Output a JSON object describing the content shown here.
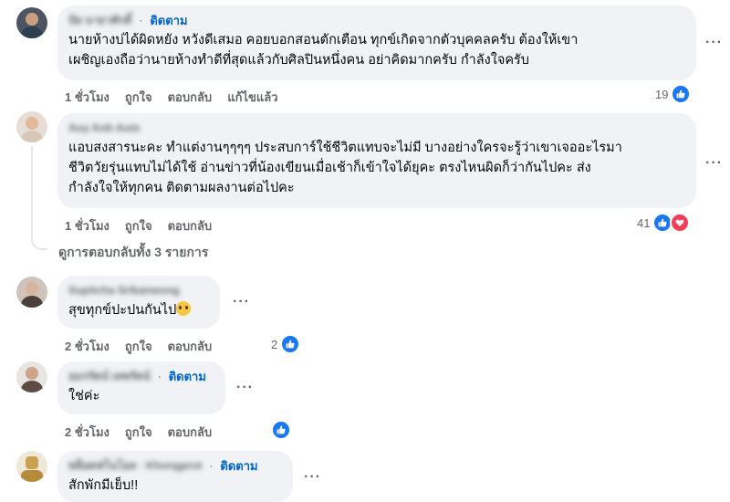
{
  "comments": [
    {
      "author": "ปัย นายาศักดิ์",
      "follow": "ติดตาม",
      "lines": [
        "นายห้างบ่ได้ผิดหยัง หวังดีเสมอ คอยบอกสอนตักเตือน ทุกข์เกิดจากตัวบุคคลครับ ต้องให้เขา",
        "เผชิญเองถือว่านายห้างทำดีที่สุดแล้วกับศิลปินหนึ่งคน อย่าคิดมากครับ กำลังใจครับ"
      ],
      "time": "1 ชั่วโมง",
      "like": "ถูกใจ",
      "reply": "ตอบกลับ",
      "edited": "แก้ไขแล้ว",
      "reaction_count": "19",
      "more": "···"
    },
    {
      "author": "Aoy Aob Aum",
      "lines": [
        "แอบสงสารนะคะ ทำแต่งานๆๆๆๆ ประสบการ์ใช้ชีวิตแทบจะไม่มี บางอย่างใครจะรู้ว่าเขาเจออะไรมา",
        "ชีวิตวัยรุ่นแทบไม่ได้ใช้ อ่านข่าวที่น้องเขียนเมื่อเช้าก็เข้าใจได้ยุคะ ตรงไหนผิดก็ว่ากันไปคะ ส่ง",
        "กำลังใจให้ทุกคน ติดตามผลงานต่อไปคะ"
      ],
      "time": "1 ชั่วโมง",
      "like": "ถูกใจ",
      "reply": "ตอบกลับ",
      "reaction_count": "41",
      "more": "···",
      "view_replies": "ดูการตอบกลับทั้ง 3 รายการ"
    },
    {
      "author": "Supitcha Srikanwong",
      "text": "สุขทุกข์ปะปนกันไป",
      "time": "2 ชั่วโมง",
      "like": "ถูกใจ",
      "reply": "ตอบกลับ",
      "reaction_count": "2",
      "more": "···"
    },
    {
      "author": "อมรรัตน์ เทพรัตน์",
      "follow": "ติดตาม",
      "text": "ใช่ค่ะ",
      "time": "2 ชั่วโมง",
      "like": "ถูกใจ",
      "reply": "ตอบกลับ",
      "more": "···"
    },
    {
      "author": "พล็อตฟโนโอล · Khongprot",
      "follow": "ติดตาม",
      "text": "สักพักมีเย็บ!!",
      "more": "···"
    }
  ],
  "colors": {
    "link": "#0064d1",
    "like_blue": "#1877f2",
    "love_red": "#f33e58",
    "bubble": "#f0f2f5",
    "meta": "#65676b"
  }
}
